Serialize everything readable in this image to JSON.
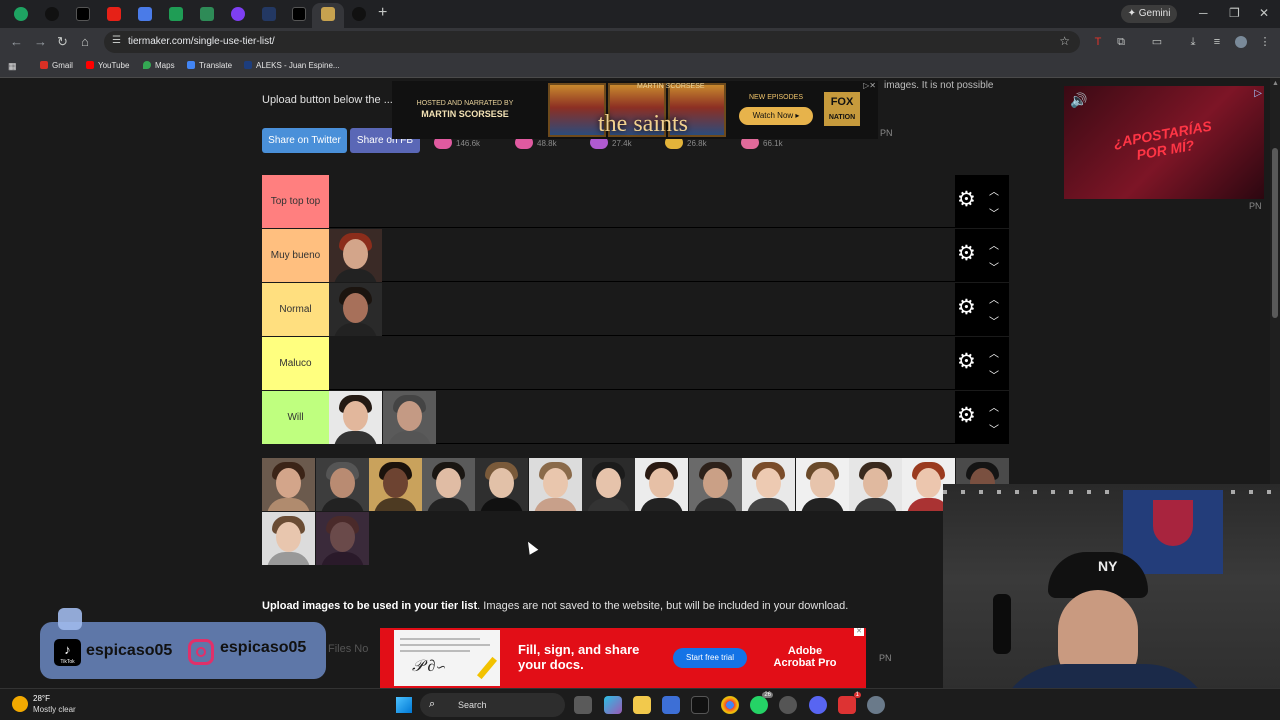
{
  "browser": {
    "url": "tiermaker.com/single-use-tier-list/",
    "gemini_label": "Gemini",
    "bookmarks": [
      "Gmail",
      "YouTube",
      "Maps",
      "Translate",
      "ALEKS - Juan Espine..."
    ]
  },
  "page": {
    "intro_text": "Upload button below the ... to save a single-use tier lis",
    "intro_right_text": "images. It is not possible",
    "share_twitter": "Share on Twitter",
    "share_fb": "Share on FB",
    "reactions": [
      "146.6k",
      "48.8k",
      "27.4k",
      "26.8k",
      "66.1k"
    ],
    "tiers": [
      {
        "label": "Top top top",
        "color": "#ff7f7f",
        "count": 0
      },
      {
        "label": "Muy bueno",
        "color": "#ffbf7f",
        "count": 1
      },
      {
        "label": "Normal",
        "color": "#ffdf7f",
        "count": 1
      },
      {
        "label": "Maluco",
        "color": "#ffff7f",
        "count": 0
      },
      {
        "label": "Will",
        "color": "#bfff7f",
        "count": 2
      }
    ],
    "pool_count": 16,
    "upload_bold": "Upload images to be used in your tier list",
    "upload_rest": ". Images are not saved to the website, but will be included in your download.",
    "files_not": "Files  No"
  },
  "ads": {
    "top": {
      "narrated": "HOSTED AND NARRATED BY",
      "narrator": "MARTIN SCORSESE",
      "header": "MARTIN SCORSESE",
      "title": "the saints",
      "new_episodes": "NEW EPISODES",
      "watch_now": "Watch Now",
      "brand": "FOX",
      "brand_sub": "NATION"
    },
    "right": {
      "slogan": "¿APOSTARÍAS POR MÍ?"
    },
    "pn_labels": [
      "PN",
      "PN",
      "PN"
    ],
    "bottom": {
      "headline": "Fill, sign, and share your docs.",
      "cta": "Start free trial",
      "brand": "Adobe Acrobat Pro"
    }
  },
  "overlay": {
    "tiktok_handle": "espicaso05",
    "instagram_handle": "espicaso05",
    "tiktok_label": "TikTok"
  },
  "taskbar": {
    "temperature": "28°F",
    "weather": "Mostly clear",
    "search_label": "Search",
    "badges": [
      "26",
      "1"
    ]
  }
}
